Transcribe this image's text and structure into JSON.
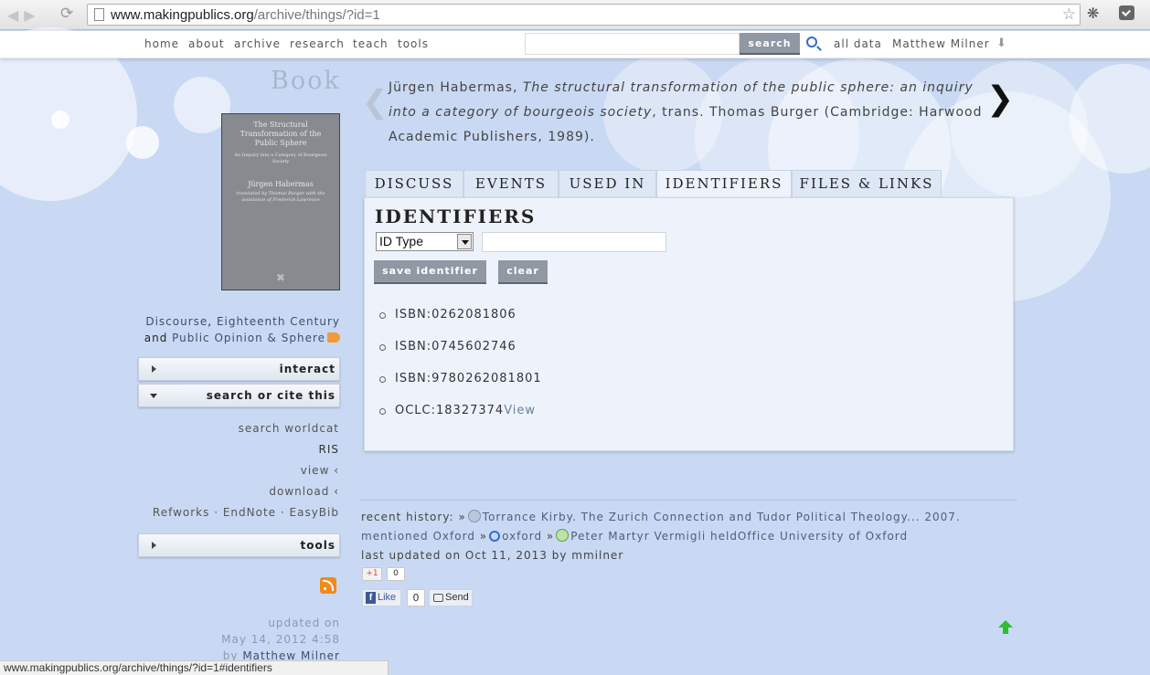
{
  "browser": {
    "url_domain": "www.makingpublics.org",
    "url_path": "/archive/things/?id=1"
  },
  "topnav": {
    "links": [
      "home",
      "about",
      "archive",
      "research",
      "teach",
      "tools"
    ],
    "search_button": "search",
    "all_data": "all data",
    "user": "Matthew Milner"
  },
  "item": {
    "type": "Book",
    "cover": {
      "title": "The Structural Transformation of the Public Sphere",
      "subtitle": "An Inquiry into a Category of Bourgeois Society",
      "author": "Jürgen Habermas",
      "translators": "translated by Thomas Burger with the assistance of Frederick Lawrence"
    },
    "citation": {
      "author": "Jürgen Habermas, ",
      "title": "The structural transformation of the public sphere: an inquiry into a category of bourgeois society",
      "rest": ", trans. Thomas Burger (Cambridge: Harwood Academic Publishers, 1989)."
    },
    "tags": {
      "t1": "Discourse",
      "sep1": ", ",
      "t2": "Eighteenth Century",
      "and": "and ",
      "t3": "Public Opinion & Sphere"
    }
  },
  "sidebar": {
    "panel_interact": "interact",
    "panel_search": "search or cite this",
    "links": {
      "worldcat": "search worldcat",
      "ris": "RIS",
      "view": "view ‹",
      "download": "download ‹",
      "refworks": "Refworks",
      "endnote": "EndNote",
      "easybib": "EasyBib",
      "dot": " · "
    },
    "panel_tools": "tools",
    "updated_label": "updated on",
    "updated_date": "May 14, 2012 4:58",
    "updated_by": "by ",
    "updated_user": "Matthew Milner"
  },
  "tabs": [
    "DISCUSS",
    "EVENTS",
    "USED IN",
    "IDENTIFIERS",
    "FILES & LINKS"
  ],
  "identifiers": {
    "heading": "IDENTIFIERS",
    "select_value": "ID Type",
    "save_button": "save identifier",
    "clear_button": "clear",
    "list": [
      "ISBN:0262081806",
      "ISBN:0745602746",
      "ISBN:9780262081801",
      "OCLC:18327374"
    ],
    "view_link": "View"
  },
  "history": {
    "label": "recent history:",
    "sep": "»",
    "item1": "Torrance Kirby. The Zurich Connection and Tudor Political Theology... 2007. mentioned Oxford",
    "item2": "oxford",
    "item3": "Peter Martyr Vermigli heldOffice University of Oxford",
    "last_updated": "last updated on Oct 11, 2013 by mmilner"
  },
  "social": {
    "gplus": "+1",
    "gplus_count": "0",
    "like": "Like",
    "like_count": "0",
    "send": "Send"
  },
  "statusbar": "www.makingpublics.org/archive/things/?id=1#identifiers"
}
